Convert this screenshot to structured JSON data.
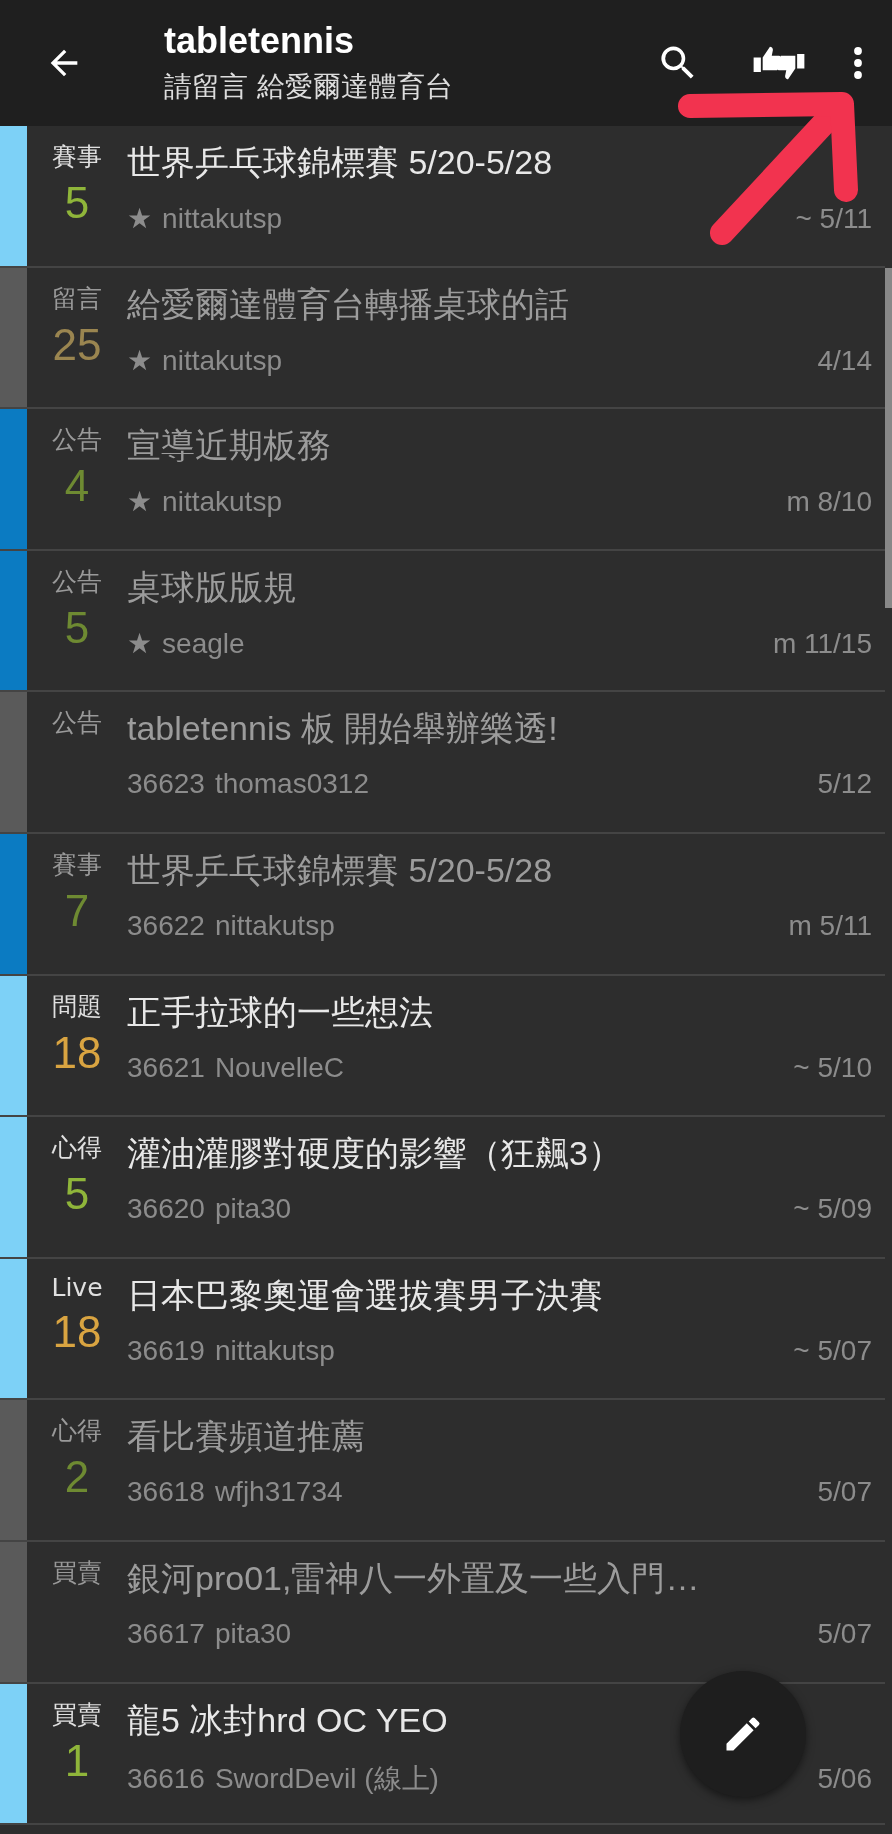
{
  "header": {
    "title": "tabletennis",
    "subtitle": "請留言 給愛爾達體育台"
  },
  "posts": [
    {
      "category": "賽事",
      "count": "5",
      "color": "#7dd1f7",
      "read": false,
      "title": "世界乒乓球錦標賽 5/20-5/28",
      "author_prefix": "★",
      "author": "nittakutsp",
      "date": "~ 5/11"
    },
    {
      "category": "留言",
      "count": "25",
      "color": "#5a5a5a",
      "read": true,
      "title": "給愛爾達體育台轉播桌球的話",
      "author_prefix": "★",
      "author": "nittakutsp",
      "date": "4/14"
    },
    {
      "category": "公告",
      "count": "4",
      "color": "#0b7bc2",
      "read": true,
      "title": "宣導近期板務",
      "author_prefix": "★",
      "author": "nittakutsp",
      "date": "m 8/10"
    },
    {
      "category": "公告",
      "count": "5",
      "color": "#0b7bc2",
      "read": true,
      "title": "桌球版版規",
      "author_prefix": "★",
      "author": "seagle",
      "date": "m 11/15"
    },
    {
      "category": "公告",
      "color": "#5a5a5a",
      "read": true,
      "title": "tabletennis 板 開始舉辦樂透!",
      "author_prefix": "36623",
      "author": "thomas0312",
      "date": "5/12"
    },
    {
      "category": "賽事",
      "count": "7",
      "color": "#0b7bc2",
      "read": true,
      "title": "世界乒乓球錦標賽 5/20-5/28",
      "author_prefix": "36622",
      "author": "nittakutsp",
      "date": "m 5/11"
    },
    {
      "category": "問題",
      "count": "18",
      "color": "#7dd1f7",
      "read": false,
      "title": "正手拉球的一些想法",
      "author_prefix": "36621",
      "author": "NouvelleC",
      "date": "~ 5/10"
    },
    {
      "category": "心得",
      "count": "5",
      "color": "#7dd1f7",
      "read": false,
      "title": "灌油灌膠對硬度的影響（狂飆3）",
      "author_prefix": "36620",
      "author": "pita30",
      "date": "~ 5/09"
    },
    {
      "category": "Live",
      "count": "18",
      "color": "#7dd1f7",
      "read": false,
      "title": "日本巴黎奧運會選拔賽男子決賽",
      "author_prefix": "36619",
      "author": "nittakutsp",
      "date": "~ 5/07"
    },
    {
      "category": "心得",
      "count": "2",
      "color": "#5a5a5a",
      "read": true,
      "title": "看比賽頻道推薦",
      "author_prefix": "36618",
      "author": "wfjh31734",
      "date": "5/07"
    },
    {
      "category": "買賣",
      "color": "#5a5a5a",
      "read": true,
      "title": "銀河pro01,雷神八一外置及一些入門…",
      "author_prefix": "36617",
      "author": "pita30",
      "date": "5/07"
    },
    {
      "category": "買賣",
      "count": "1",
      "color": "#7dd1f7",
      "read": false,
      "title": "龍5 冰封hrd OC YEO",
      "author_prefix": "36616",
      "author": "SwordDevil (線上)",
      "date": "5/06"
    }
  ]
}
